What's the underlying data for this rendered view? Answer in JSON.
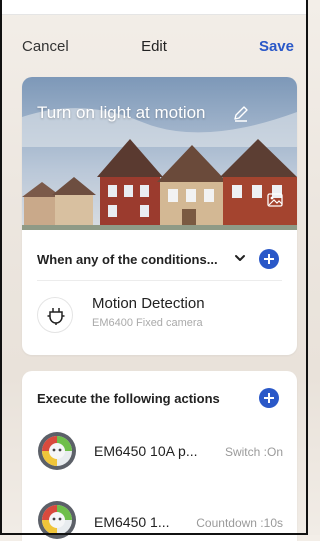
{
  "nav": {
    "cancel": "Cancel",
    "title": "Edit",
    "save": "Save"
  },
  "scene": {
    "title": "Turn on light at motion",
    "edit_icon": "pencil-icon",
    "gallery_icon": "image-icon"
  },
  "conditions": {
    "label": "When any of the conditions...",
    "items": [
      {
        "title": "Motion Detection",
        "subtitle": "EM6400 Fixed camera",
        "icon": "plug-icon"
      }
    ]
  },
  "actions": {
    "label": "Execute the following actions",
    "items": [
      {
        "name": "EM6450 10A p...",
        "status": "Switch :On",
        "icon": "smart-plug-icon"
      },
      {
        "name": "EM6450 1...",
        "status": "Countdown :10s",
        "icon": "smart-plug-icon"
      }
    ]
  },
  "colors": {
    "accent": "#2a58c8",
    "text": "#222222",
    "muted": "#9a9a9a"
  }
}
